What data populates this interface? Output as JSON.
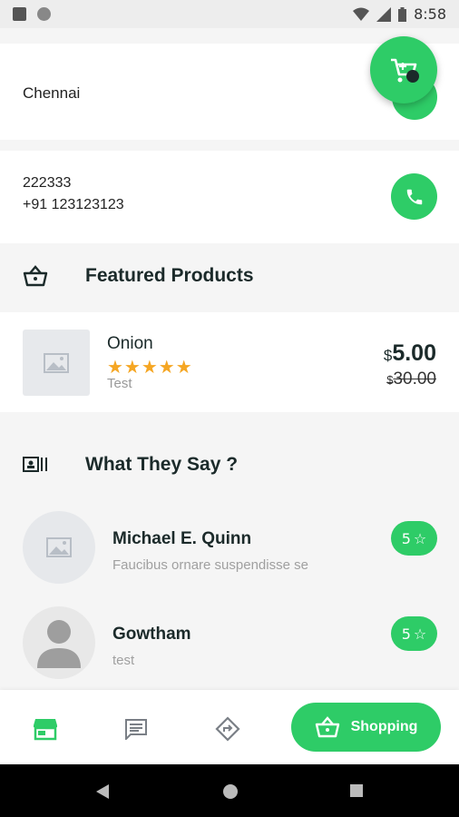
{
  "status_bar": {
    "time": "8:58"
  },
  "location": {
    "city": "Chennai"
  },
  "contact": {
    "line1": "222333",
    "line2": "+91 123123123"
  },
  "featured": {
    "title": "Featured Products",
    "product": {
      "name": "Onion",
      "rating_stars": "★★★★★",
      "note": "Test",
      "currency": "$",
      "price": "5.00",
      "old_price": "30.00"
    }
  },
  "testimonials": {
    "title": "What They Say ?",
    "items": [
      {
        "name": "Michael E. Quinn",
        "text": "Faucibus ornare suspendisse se",
        "rating": "5"
      },
      {
        "name": "Gowtham",
        "text": "test",
        "rating": "5"
      }
    ]
  },
  "bottom_nav": {
    "shopping_label": "Shopping"
  },
  "colors": {
    "accent": "#2ecc67",
    "dark": "#1b2a2a",
    "star": "#f5a623"
  }
}
